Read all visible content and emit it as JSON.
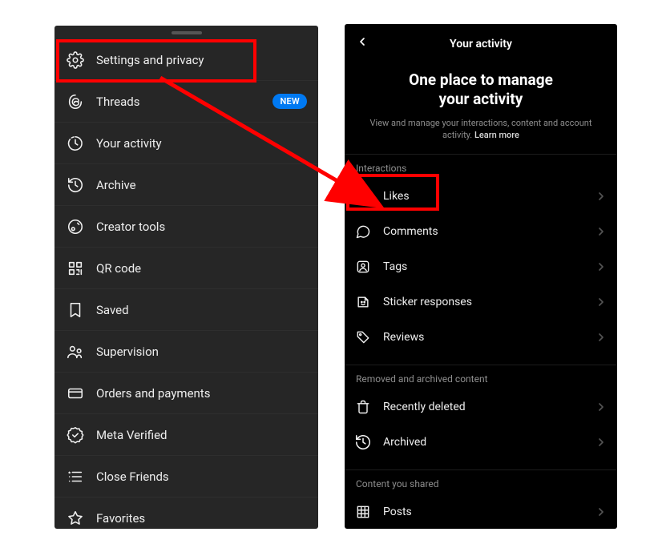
{
  "left_menu": {
    "items": [
      {
        "key": "settings",
        "label": "Settings and privacy",
        "icon": "gear"
      },
      {
        "key": "threads",
        "label": "Threads",
        "icon": "threads",
        "badge": "NEW"
      },
      {
        "key": "activity",
        "label": "Your activity",
        "icon": "clock-dashed"
      },
      {
        "key": "archive",
        "label": "Archive",
        "icon": "history"
      },
      {
        "key": "creator",
        "label": "Creator tools",
        "icon": "creator"
      },
      {
        "key": "qr",
        "label": "QR code",
        "icon": "qr"
      },
      {
        "key": "saved",
        "label": "Saved",
        "icon": "bookmark"
      },
      {
        "key": "supervision",
        "label": "Supervision",
        "icon": "supervision"
      },
      {
        "key": "orders",
        "label": "Orders and payments",
        "icon": "card"
      },
      {
        "key": "verified",
        "label": "Meta Verified",
        "icon": "verified"
      },
      {
        "key": "close_friends",
        "label": "Close Friends",
        "icon": "list-star"
      },
      {
        "key": "favorites",
        "label": "Favorites",
        "icon": "star"
      }
    ]
  },
  "right": {
    "header": "Your activity",
    "promo_title_l1": "One place to manage",
    "promo_title_l2": "your activity",
    "promo_sub": "View and manage your interactions, content and account activity.",
    "promo_learn": "Learn more",
    "sections": [
      {
        "title": "Interactions",
        "items": [
          {
            "key": "likes",
            "label": "Likes",
            "icon": "heart"
          },
          {
            "key": "comments",
            "label": "Comments",
            "icon": "comment"
          },
          {
            "key": "tags",
            "label": "Tags",
            "icon": "tag-person"
          },
          {
            "key": "stickers",
            "label": "Sticker responses",
            "icon": "sticker"
          },
          {
            "key": "reviews",
            "label": "Reviews",
            "icon": "tag"
          }
        ]
      },
      {
        "title": "Removed and archived content",
        "items": [
          {
            "key": "deleted",
            "label": "Recently deleted",
            "icon": "trash"
          },
          {
            "key": "archived",
            "label": "Archived",
            "icon": "history"
          }
        ]
      },
      {
        "title": "Content you shared",
        "items": [
          {
            "key": "posts",
            "label": "Posts",
            "icon": "grid"
          }
        ]
      }
    ]
  },
  "annotations": {
    "highlight1": "settings-row",
    "highlight2": "likes-row"
  }
}
